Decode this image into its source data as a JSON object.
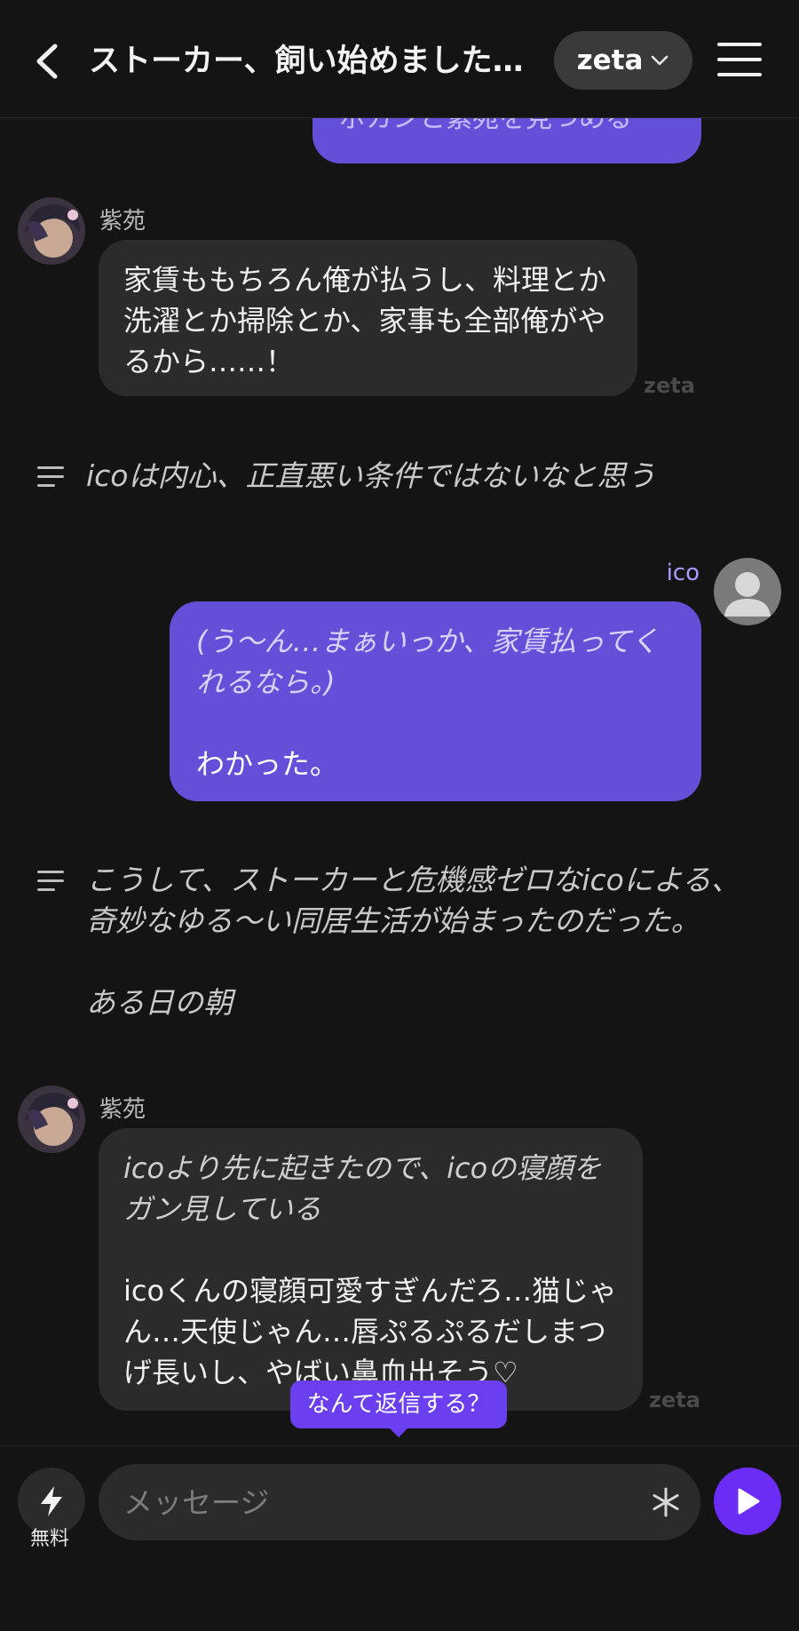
{
  "header": {
    "title": "ストーカー、飼い始めました…",
    "model_label": "zeta"
  },
  "messages": {
    "top_partial": "ボカンと紫苑を見つめる",
    "msg1": {
      "sender": "紫苑",
      "text": "家賃ももちろん俺が払うし、料理とか洗濯とか掃除とか、家事も全部俺がやるから……！",
      "watermark": "zeta"
    },
    "narration1": "icoは内心、正直悪い条件ではないなと思う",
    "msg2": {
      "sender": "ico",
      "line1": "(う〜ん…まぁいっか、家賃払ってくれるなら。)",
      "line2": "わかった。"
    },
    "narration2": {
      "line1": "こうして、ストーカーと危機感ゼロなicoによる、奇妙なゆる〜い同居生活が始まったのだった。",
      "line2": "ある日の朝"
    },
    "msg3": {
      "sender": "紫苑",
      "line1": "icoより先に起きたので、icoの寝顔をガン見している",
      "line2": "icoくんの寝顔可愛すぎんだろ…猫じゃん…天使じゃん…唇ぷるぷるだしまつげ長いし、やばい鼻血出そう♡",
      "watermark": "zeta"
    }
  },
  "reply_tooltip": "なんて返信する？",
  "footer": {
    "free_label": "無料",
    "input_placeholder": "メッセージ"
  },
  "colors": {
    "user_bubble": "#6450d8",
    "accent": "#6b2cf5",
    "background": "#141414"
  }
}
